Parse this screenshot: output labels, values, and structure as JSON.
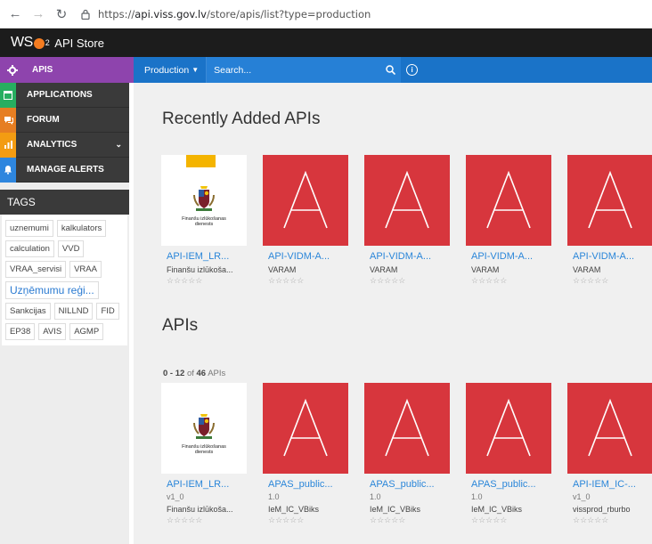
{
  "browser": {
    "url_prefix": "https://",
    "url_domain": "api.viss.gov.lv",
    "url_path": "/store/apis/list?type=production"
  },
  "header": {
    "logo_w": "WS",
    "logo_o": "O",
    "logo_sub": "2",
    "title": "API Store"
  },
  "topnav": {
    "apis_label": "APIS",
    "environment": "Production",
    "search_placeholder": "Search..."
  },
  "sidebar": {
    "items": [
      {
        "label": "APPLICATIONS",
        "icon": "applications-icon"
      },
      {
        "label": "FORUM",
        "icon": "forum-icon"
      },
      {
        "label": "ANALYTICS",
        "icon": "analytics-icon"
      },
      {
        "label": "MANAGE ALERTS",
        "icon": "bell-icon"
      }
    ],
    "tags_title": "TAGS",
    "tags": [
      "uznemumi",
      "kalkulators",
      "calculation",
      "VVD",
      "VRAA_servisi",
      "VRAA",
      "Uzņēmumu reģi...",
      "Sankcijas",
      "NILLND",
      "FID",
      "EP38",
      "AVIS",
      "AGMP"
    ]
  },
  "recent": {
    "title": "Recently Added APIs",
    "cards": [
      {
        "name": "API-IEM_LR...",
        "provider": "Finanšu izlūkoša...",
        "stars": "☆☆☆☆☆",
        "thumb": "logo",
        "agency": [
          "Finanšu izlūkošanas",
          "dienests"
        ]
      },
      {
        "name": "API-VIDM-A...",
        "provider": "VARAM",
        "stars": "☆☆☆☆☆",
        "thumb": "letter",
        "letter": "A"
      },
      {
        "name": "API-VIDM-A...",
        "provider": "VARAM",
        "stars": "☆☆☆☆☆",
        "thumb": "letter",
        "letter": "A"
      },
      {
        "name": "API-VIDM-A...",
        "provider": "VARAM",
        "stars": "☆☆☆☆☆",
        "thumb": "letter",
        "letter": "A"
      },
      {
        "name": "API-VIDM-A...",
        "provider": "VARAM",
        "stars": "☆☆☆☆☆",
        "thumb": "letter",
        "letter": "A"
      }
    ]
  },
  "apis": {
    "title": "APIs",
    "count_range": "0 - 12",
    "count_of": "of",
    "count_total": "46",
    "count_unit": "APIs",
    "cards": [
      {
        "name": "API-IEM_LR...",
        "version": "v1_0",
        "provider": "Finanšu izlūkoša...",
        "stars": "☆☆☆☆☆",
        "thumb": "logo",
        "agency": [
          "Finanšu izlūkošanas",
          "dienests"
        ]
      },
      {
        "name": "APAS_public...",
        "version": "1.0",
        "provider": "IeM_IC_VBiks",
        "stars": "☆☆☆☆☆",
        "thumb": "letter",
        "letter": "A"
      },
      {
        "name": "APAS_public...",
        "version": "1.0",
        "provider": "IeM_IC_VBiks",
        "stars": "☆☆☆☆☆",
        "thumb": "letter",
        "letter": "A"
      },
      {
        "name": "APAS_public...",
        "version": "1.0",
        "provider": "IeM_IC_VBiks",
        "stars": "☆☆☆☆☆",
        "thumb": "letter",
        "letter": "A"
      },
      {
        "name": "API-IEM_IC-...",
        "version": "v1_0",
        "provider": "vissprod_rburbo",
        "stars": "☆☆☆☆☆",
        "thumb": "letter",
        "letter": "A"
      }
    ]
  },
  "colors": {
    "purple": "#8e44ad",
    "blue": "#1a73c8",
    "thumb_red": "#d7363d",
    "link_blue": "#2a86d9"
  }
}
